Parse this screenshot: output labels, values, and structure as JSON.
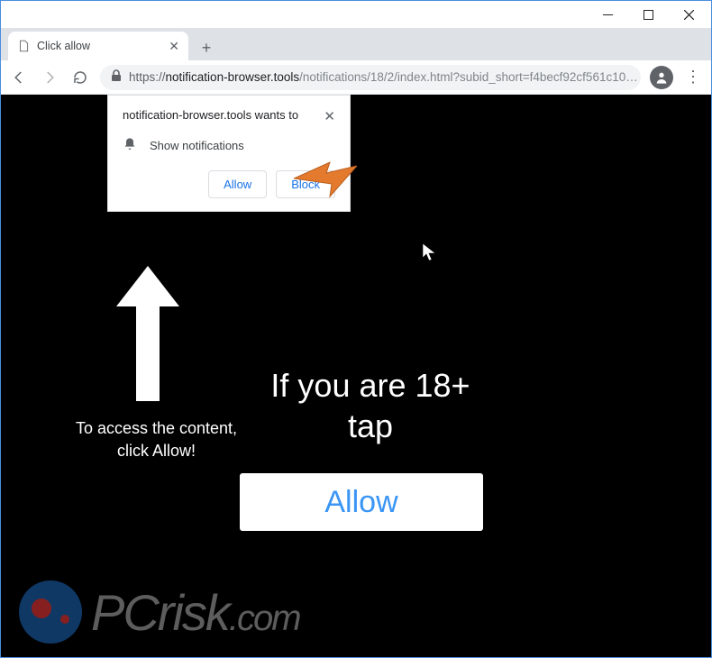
{
  "window": {
    "tab_title": "Click allow"
  },
  "addressbar": {
    "protocol": "https://",
    "host": "notification-browser.tools",
    "path": "/notifications/18/2/index.html?subid_short=f4becf92cf561c10…"
  },
  "permission": {
    "head": "notification-browser.tools wants to",
    "line": "Show notifications",
    "allow_label": "Allow",
    "block_label": "Block"
  },
  "page": {
    "caption_line1": "To access the content,",
    "caption_line2": "click Allow!",
    "headline_line1": "If you are 18+",
    "headline_line2": "tap",
    "big_button": "Allow"
  },
  "watermark": {
    "text": "PCrisk",
    "tld": ".com"
  }
}
